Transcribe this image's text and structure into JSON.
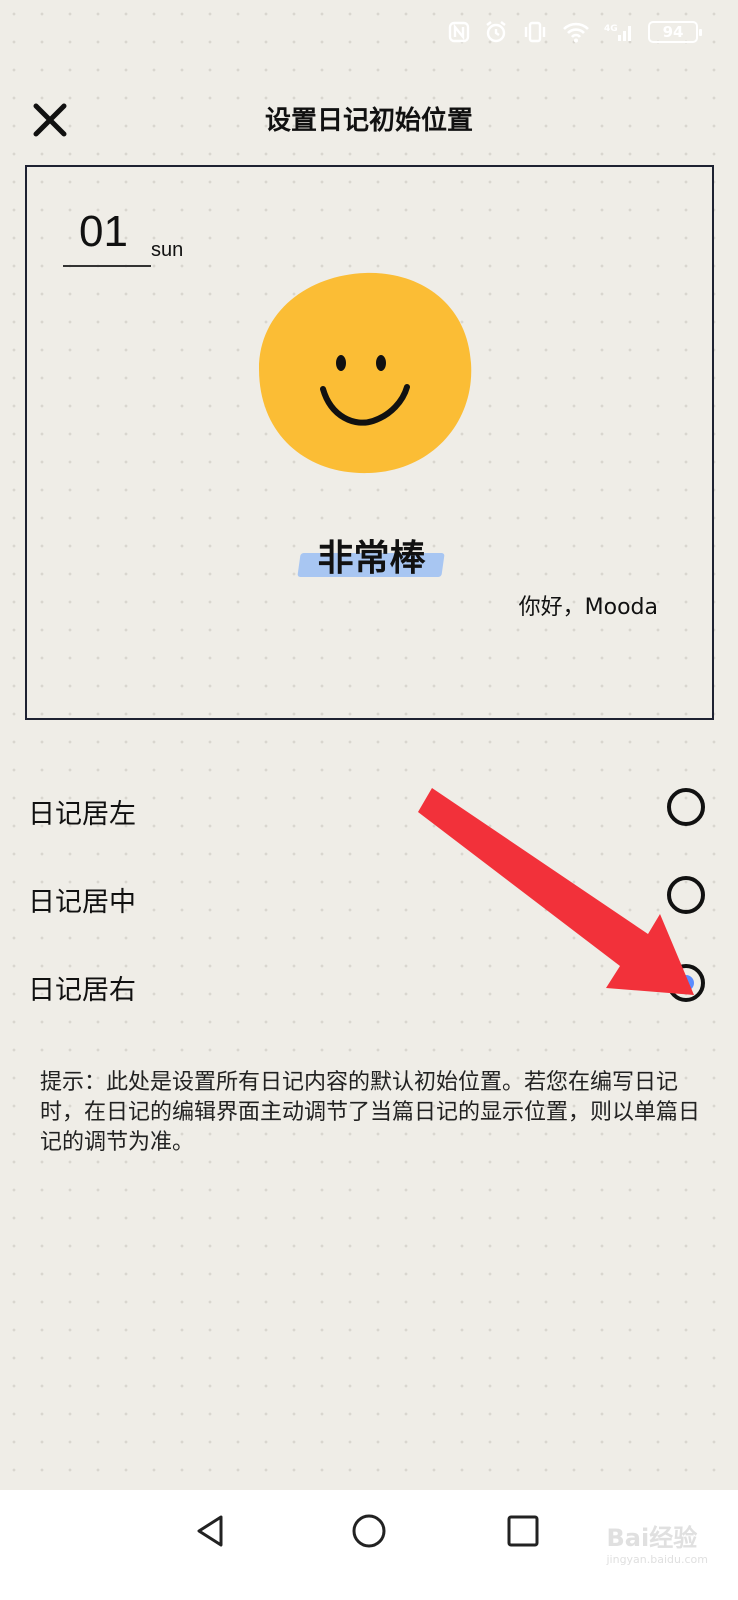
{
  "status_bar": {
    "battery": "94"
  },
  "header": {
    "title": "设置日记初始位置",
    "close_icon": "close-icon"
  },
  "preview": {
    "date_number": "01",
    "date_day": "sun",
    "mood": "非常棒",
    "greeting": "你好，Mooda",
    "face_color": "#fbbd35",
    "highlight_color": "#a8c6f2"
  },
  "options": [
    {
      "label": "日记居左",
      "selected": false
    },
    {
      "label": "日记居中",
      "selected": false
    },
    {
      "label": "日记居右",
      "selected": true
    }
  ],
  "hint": "提示：此处是设置所有日记内容的默认初始位置。若您在编写日记时，在日记的编辑界面主动调节了当篇日记的显示位置，则以单篇日记的调节为准。",
  "navigation": {
    "back": "back-icon",
    "home": "home-icon",
    "recents": "recents-icon"
  },
  "watermark": {
    "text": "Bai经验",
    "url_text": "jingyan.baidu.com"
  },
  "accent_color": "#f2313a"
}
